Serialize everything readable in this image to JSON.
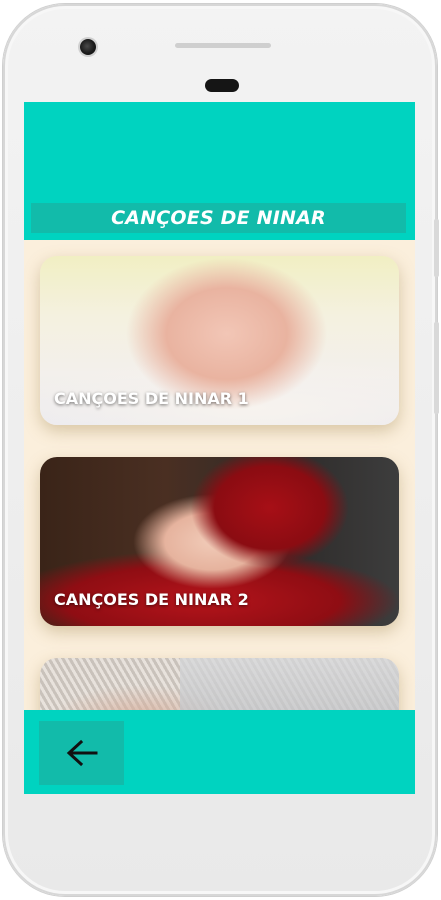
{
  "app": {
    "title": "CANÇOES DE NINAR"
  },
  "colors": {
    "accent": "#00d3c0",
    "accent_dark": "#12bbaa",
    "list_background": "#fbefdc"
  },
  "cards": [
    {
      "label": "CANÇOES DE NINAR 1"
    },
    {
      "label": "CANÇOES DE NINAR 2"
    },
    {
      "label": ""
    }
  ],
  "navigation": {
    "back_icon": "arrow-left-icon"
  }
}
